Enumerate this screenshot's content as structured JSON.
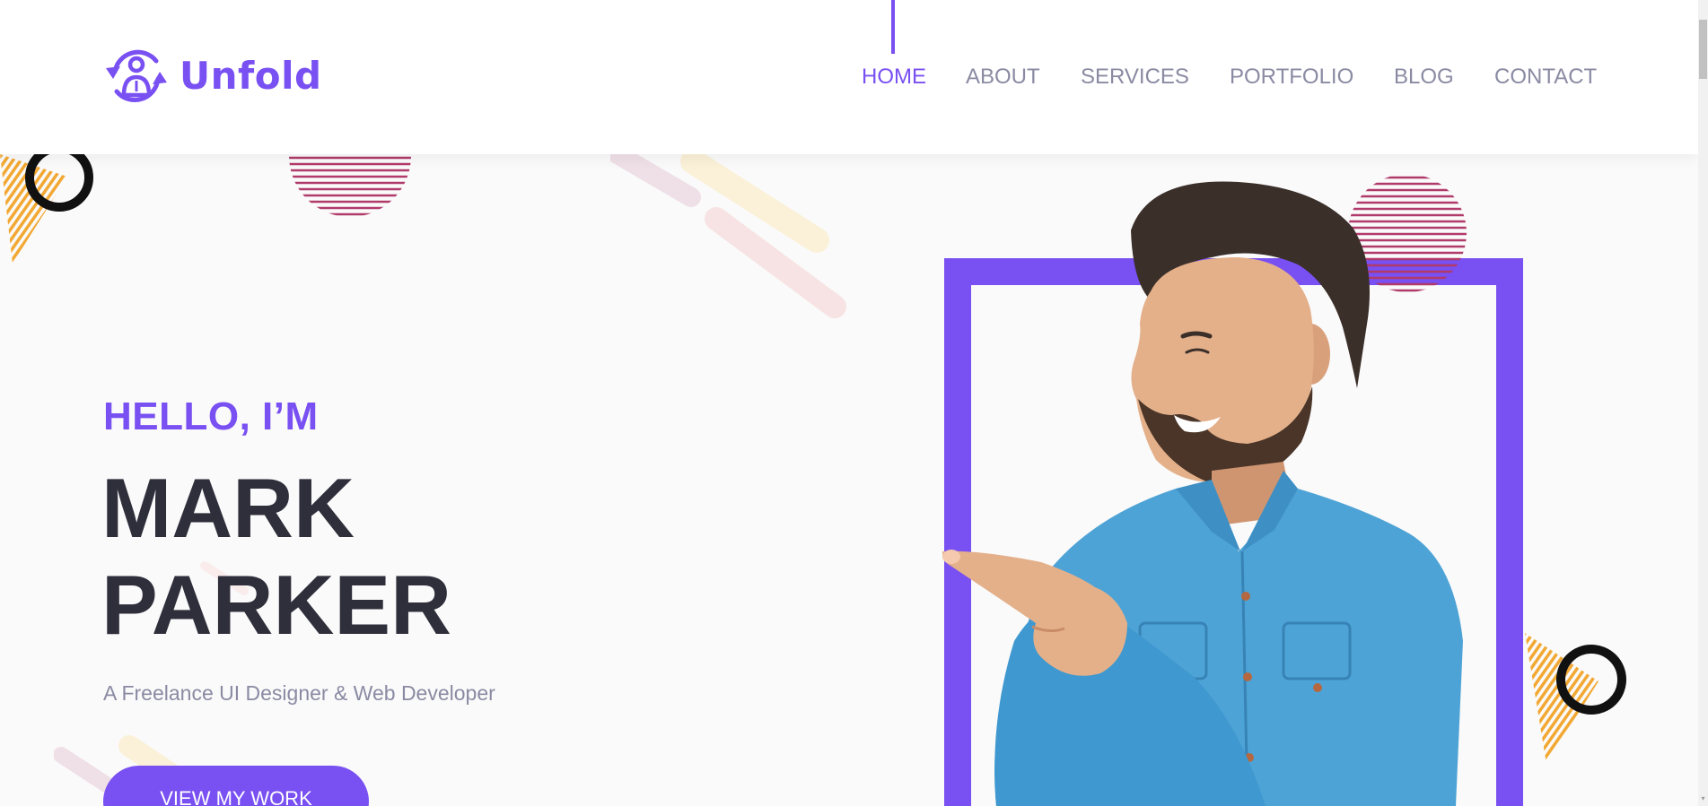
{
  "brand": {
    "name": "Unfold",
    "accent_color": "#7950f2",
    "logo_icon": "user-sync-icon"
  },
  "nav": {
    "items": [
      {
        "label": "HOME",
        "active": true
      },
      {
        "label": "ABOUT",
        "active": false
      },
      {
        "label": "SERVICES",
        "active": false
      },
      {
        "label": "PORTFOLIO",
        "active": false
      },
      {
        "label": "BLOG",
        "active": false
      },
      {
        "label": "CONTACT",
        "active": false
      }
    ]
  },
  "hero": {
    "greeting": "HELLO, I’M",
    "first_name": "MARK",
    "last_name": "PARKER",
    "tagline": "A Freelance UI Designer & Web Developer",
    "cta_label": "VIEW MY WORK",
    "image": "man-pointing-photo"
  },
  "colors": {
    "text_dark": "#2f2e3b",
    "text_muted": "#8a8aa3",
    "stripe_red": "#b03a6a",
    "stripe_yellow": "#f2a833",
    "ring_black": "#111111"
  }
}
